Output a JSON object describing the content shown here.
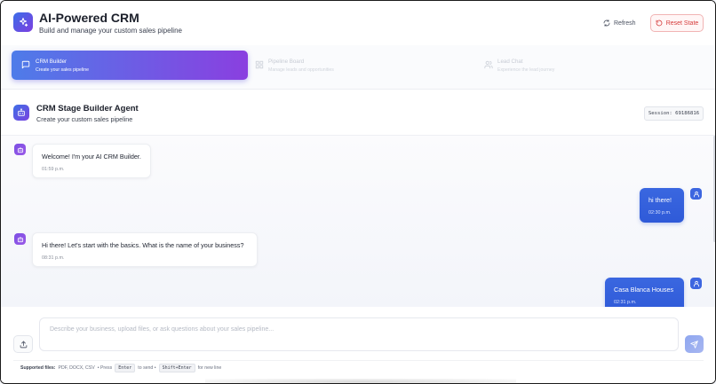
{
  "header": {
    "title": "AI-Powered CRM",
    "subtitle": "Build and manage your custom sales pipeline",
    "refresh_label": "Refresh",
    "reset_label": "Reset State"
  },
  "tabs": [
    {
      "label": "CRM Builder",
      "desc": "Create your sales pipeline",
      "active": true,
      "icon": "message-square-icon"
    },
    {
      "label": "Pipeline Board",
      "desc": "Manage leads and opportunities",
      "active": false,
      "icon": "grid-icon"
    },
    {
      "label": "Lead Chat",
      "desc": "Experience the lead journey",
      "active": false,
      "icon": "users-icon"
    }
  ],
  "agent": {
    "title": "CRM Stage Builder Agent",
    "subtitle": "Create your custom sales pipeline",
    "session": "Session: 69186816"
  },
  "messages": [
    {
      "role": "bot",
      "text": "Welcome! I'm your AI CRM Builder.",
      "time": "01:59 p.m."
    },
    {
      "role": "user",
      "text": "hi there!",
      "time": "02:30 p.m."
    },
    {
      "role": "bot",
      "text": "Hi there! Let's start with the basics. What is the name of your business?",
      "time": "08:31 p.m."
    },
    {
      "role": "user",
      "text": "Casa Blanca Houses",
      "time": "02:31 p.m."
    }
  ],
  "composer": {
    "placeholder": "Describe your business, upload files, or ask questions about your sales pipeline...",
    "value": ""
  },
  "footer": {
    "supported_label": "Supported files:",
    "supported_types": "PDF, DOCX, CSV",
    "sep1": "• Press",
    "key_send": "Enter",
    "send_text": "to send •",
    "key_newline": "Shift+Enter",
    "newline_text": "for new line"
  },
  "colors": {
    "accent_start": "#4e7ce9",
    "accent_end": "#8a3fe0",
    "user_bubble": "#3a67e0",
    "reset_red": "#d53b3b"
  }
}
